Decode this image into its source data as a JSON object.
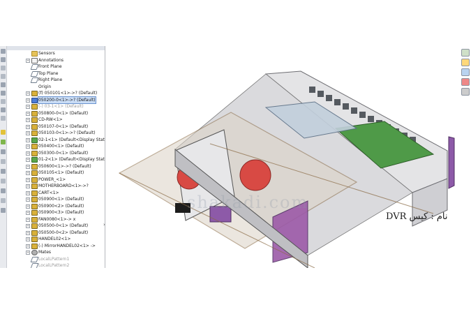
{
  "feature_tree": {
    "top_partial": "",
    "items": [
      {
        "label": "Sensors",
        "icon": "folder",
        "expander": ""
      },
      {
        "label": "Annotations",
        "icon": "anno",
        "expander": "+"
      },
      {
        "label": "Front Plane",
        "icon": "plane",
        "expander": ""
      },
      {
        "label": "Top Plane",
        "icon": "plane",
        "expander": ""
      },
      {
        "label": "Right Plane",
        "icon": "plane",
        "expander": ""
      },
      {
        "label": "Origin",
        "icon": "origin",
        "expander": ""
      },
      {
        "label": "(f) 050101<1>->? (Default)",
        "icon": "part",
        "expander": "+"
      },
      {
        "label": "050200-0<1>->? (Default)",
        "icon": "partb",
        "expander": "+",
        "selected": true
      },
      {
        "label": "(-) 03-1<1> (Default)",
        "icon": "part",
        "expander": "+",
        "gray": true
      },
      {
        "label": "050800-0<1> (Default)",
        "icon": "part",
        "expander": "+"
      },
      {
        "label": "CD-RW<1>",
        "icon": "part",
        "expander": "+"
      },
      {
        "label": "050107-0<1> (Default)",
        "icon": "part",
        "expander": "+"
      },
      {
        "label": "050103-0<1>->? (Default)",
        "icon": "part",
        "expander": "+"
      },
      {
        "label": "02-1<1> (Default<Display State-1>)",
        "icon": "partg",
        "expander": "+"
      },
      {
        "label": "050400<1> (Default)",
        "icon": "part",
        "expander": "+"
      },
      {
        "label": "050300-0<1> (Default)",
        "icon": "part",
        "expander": "+"
      },
      {
        "label": "01-2<1> (Default<Display State-1>)",
        "icon": "partg",
        "expander": "+"
      },
      {
        "label": "050600<1>->? (Default)",
        "icon": "part",
        "expander": "+"
      },
      {
        "label": "050105<1> (Default)",
        "icon": "part",
        "expander": "+"
      },
      {
        "label": "POWER_<1>",
        "icon": "part",
        "expander": "+"
      },
      {
        "label": "MOTHERBOARD<1>->?",
        "icon": "part",
        "expander": "+"
      },
      {
        "label": "CART<1>",
        "icon": "part",
        "expander": "+"
      },
      {
        "label": "050900<1> (Default)",
        "icon": "part",
        "expander": "+"
      },
      {
        "label": "050900<2> (Default)",
        "icon": "part",
        "expander": "+"
      },
      {
        "label": "050900<3> (Default)",
        "icon": "part",
        "expander": "+"
      },
      {
        "label": "FAN0080<1>-> x",
        "icon": "part",
        "expander": "+"
      },
      {
        "label": "050500-0<1> (Default)",
        "icon": "part",
        "expander": "+"
      },
      {
        "label": "050500-0<2> (Default)",
        "icon": "part",
        "expander": "+"
      },
      {
        "label": "HANDEL02<1>",
        "icon": "part",
        "expander": "+"
      },
      {
        "label": "(-) MirrorHANDEL02<1> ->",
        "icon": "part",
        "expander": "+"
      },
      {
        "label": "Mates",
        "icon": "mates",
        "expander": "+"
      },
      {
        "label": "LocalLPattern1",
        "icon": "plane",
        "expander": "",
        "gray": true
      },
      {
        "label": "LocalLPattern2",
        "icon": "plane",
        "expander": "",
        "gray": true
      }
    ]
  },
  "caption": "نام : کیس DVR",
  "watermark": "shakadi.com",
  "right_toolbar": [
    "view-palette-icon",
    "appearance-icon",
    "scene-icon",
    "display-icon",
    "custom-icon"
  ],
  "colors": {
    "selection": "#c9dcf5",
    "case_metal": "#d7d7d9",
    "glass_panel": "#c2cfdc",
    "board_green": "#4f9a48",
    "purple_part": "#8d5aa8",
    "red_part": "#d84a44"
  }
}
